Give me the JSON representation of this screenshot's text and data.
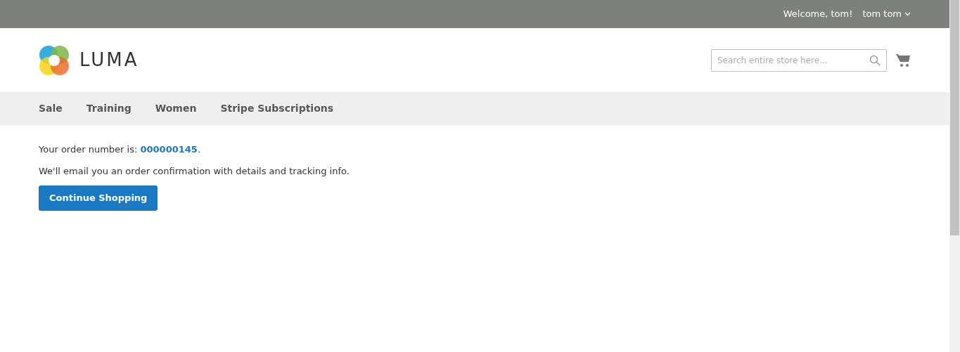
{
  "header": {
    "welcome": "Welcome, tom!",
    "account": "tom tom"
  },
  "logo": {
    "text": "LUMA"
  },
  "search": {
    "placeholder": "Search entire store here..."
  },
  "nav": [
    {
      "label": "Sale"
    },
    {
      "label": "Training"
    },
    {
      "label": "Women"
    },
    {
      "label": "Stripe Subscriptions"
    }
  ],
  "order": {
    "prefix": "Your order number is: ",
    "number": "000000145",
    "suffix": ".",
    "message": "We'll email you an order confirmation with details and tracking info.",
    "button": "Continue Shopping"
  }
}
